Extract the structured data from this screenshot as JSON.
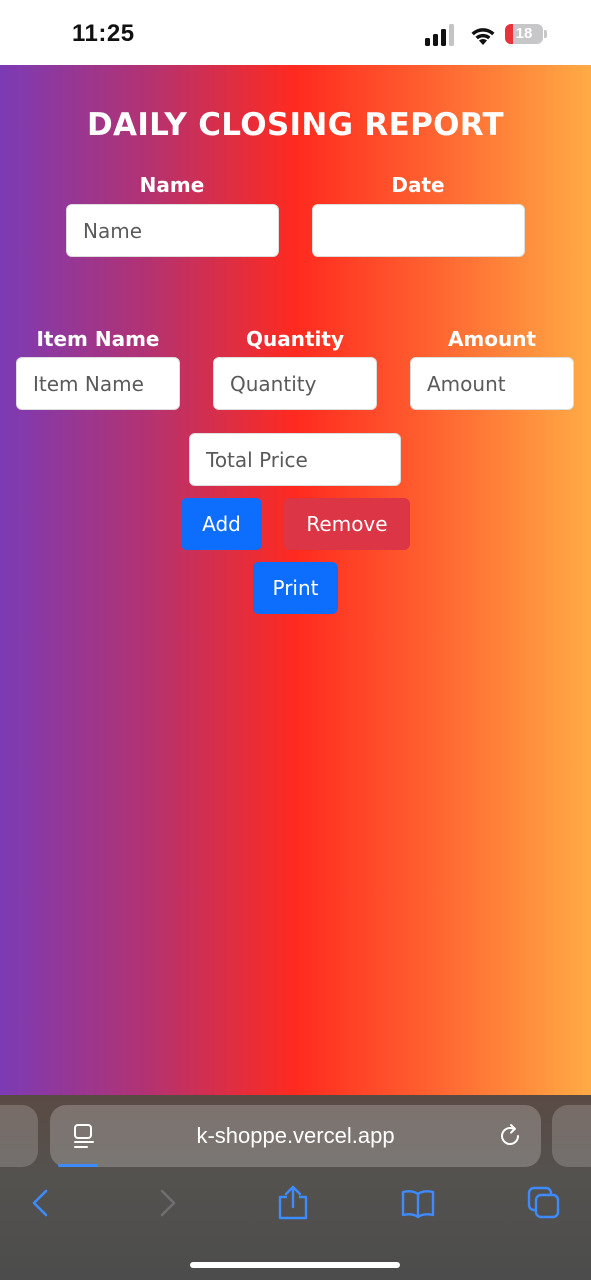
{
  "status_bar": {
    "time": "11:25",
    "battery_level": "18"
  },
  "app": {
    "title": "DAILY CLOSING REPORT",
    "name_label": "Name",
    "name_placeholder": "Name",
    "date_label": "Date",
    "date_value": "",
    "item_name_label": "Item Name",
    "item_name_placeholder": "Item Name",
    "quantity_label": "Quantity",
    "quantity_placeholder": "Quantity",
    "amount_label": "Amount",
    "amount_placeholder": "Amount",
    "total_price_placeholder": "Total Price",
    "add_label": "Add",
    "remove_label": "Remove",
    "print_label": "Print",
    "colors": {
      "gradient": [
        "#7b3bb5",
        "#b33272",
        "#ff2a1f",
        "#ff5a2e",
        "#ffab45"
      ],
      "primary": "#0d6efd",
      "danger": "#dc3545"
    }
  },
  "browser": {
    "url": "k-shoppe.vercel.app",
    "icons": [
      "page-menu-icon",
      "reload-icon",
      "back-icon",
      "forward-icon",
      "share-icon",
      "bookmarks-icon",
      "tabs-icon"
    ]
  }
}
